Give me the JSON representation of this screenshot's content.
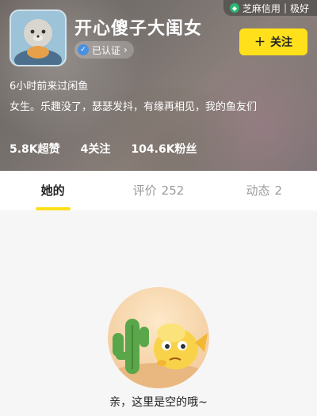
{
  "header": {
    "credit": {
      "brand": "芝麻信用",
      "level": "极好"
    },
    "nickname": "开心傻子大闺女",
    "verified_label": "已认证",
    "follow_button": "关注",
    "last_active": "6小时前来过闲鱼",
    "bio": "女生。乐趣没了，瑟瑟发抖，有缘再相见，我的鱼友们",
    "stats": [
      {
        "value": "5.8K",
        "label": "超赞"
      },
      {
        "value": "4",
        "label": "关注"
      },
      {
        "value": "104.6K",
        "label": "粉丝"
      }
    ]
  },
  "tabs": [
    {
      "label": "她的",
      "count": "",
      "active": true
    },
    {
      "label": "评价",
      "count": "252",
      "active": false
    },
    {
      "label": "动态",
      "count": "2",
      "active": false
    }
  ],
  "empty_state": {
    "message": "亲，这里是空的哦~"
  },
  "colors": {
    "accent": "#ffe01b",
    "credit_green": "#2bb673"
  }
}
